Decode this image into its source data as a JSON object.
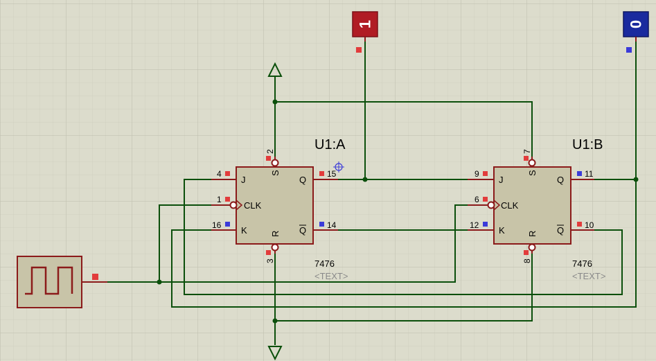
{
  "colors": {
    "background": "#dcdccc",
    "grid_minor": "#cfcfbf",
    "grid_major": "#bdbdac",
    "wire": "#0b4f0b",
    "component_outline": "#8b1a1a",
    "component_body": "#c8c4a8",
    "pin_marker_low": "#e23c3c",
    "pin_marker_high": "#3b3bd9",
    "logic_state_one": "#b01c24",
    "logic_state_zero": "#1a2a9e"
  },
  "logic_state_one": {
    "value": "1"
  },
  "logic_state_zero": {
    "value": "0"
  },
  "flipflops": [
    {
      "name": "U1:A",
      "type": "7476",
      "text_placeholder": "<TEXT>",
      "pins": {
        "j": "4",
        "clk": "1",
        "k": "16",
        "s": "2",
        "r": "3",
        "q": "15",
        "qbar": "14"
      }
    },
    {
      "name": "U1:B",
      "type": "7476",
      "text_placeholder": "<TEXT>",
      "pins": {
        "j": "9",
        "clk": "6",
        "k": "12",
        "s": "7",
        "r": "8",
        "q": "11",
        "qbar": "10"
      }
    }
  ],
  "pin_labels": {
    "j": "J",
    "clk": "CLK",
    "k": "K",
    "s": "S",
    "r": "R",
    "q": "Q",
    "qbar": "Q"
  }
}
